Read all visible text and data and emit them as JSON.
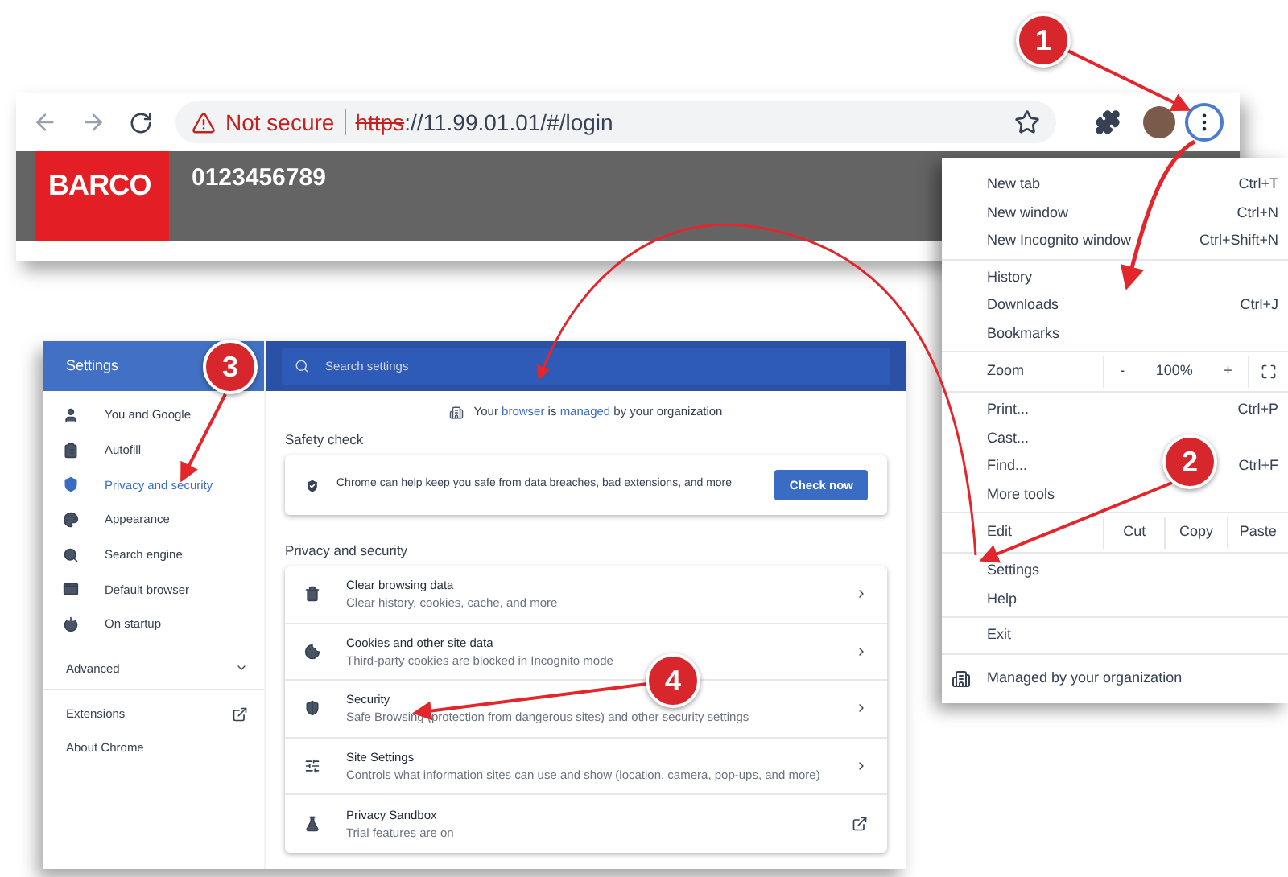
{
  "browser": {
    "warning": "Not secure",
    "url_scheme": "https",
    "url_rest": "://11.99.01.01/#/login",
    "logo": "BARCO",
    "device_id": "0123456789"
  },
  "menu": {
    "groups": [
      [
        {
          "kind": "item",
          "label": "New tab",
          "shortcut": "Ctrl+T"
        },
        {
          "kind": "item",
          "label": "New window",
          "shortcut": "Ctrl+N"
        },
        {
          "kind": "item",
          "label": "New Incognito window",
          "shortcut": "Ctrl+Shift+N"
        }
      ],
      [
        {
          "kind": "item",
          "label": "History"
        },
        {
          "kind": "item",
          "label": "Downloads",
          "shortcut": "Ctrl+J"
        },
        {
          "kind": "item",
          "label": "Bookmarks"
        }
      ],
      [
        {
          "kind": "zoom",
          "label": "Zoom",
          "minus": "-",
          "value": "100%",
          "plus": "+"
        }
      ],
      [
        {
          "kind": "item",
          "label": "Print...",
          "shortcut": "Ctrl+P"
        },
        {
          "kind": "item",
          "label": "Cast..."
        },
        {
          "kind": "item",
          "label": "Find...",
          "shortcut": "Ctrl+F"
        },
        {
          "kind": "item",
          "label": "More tools"
        }
      ],
      [
        {
          "kind": "edit",
          "label": "Edit",
          "actions": [
            "Cut",
            "Copy",
            "Paste"
          ]
        }
      ],
      [
        {
          "kind": "item",
          "label": "Settings"
        },
        {
          "kind": "item",
          "label": "Help"
        }
      ],
      [
        {
          "kind": "item",
          "label": "Exit"
        }
      ]
    ],
    "footer": "Managed by your organization"
  },
  "settings": {
    "title": "Settings",
    "search": {
      "placeholder": "Search settings"
    },
    "sidebar": [
      {
        "label": "You and Google",
        "selected": false
      },
      {
        "label": "Autofill",
        "selected": false
      },
      {
        "label": "Privacy and security",
        "selected": true
      },
      {
        "label": "Appearance",
        "selected": false
      },
      {
        "label": "Search engine",
        "selected": false
      },
      {
        "label": "Default browser",
        "selected": false
      },
      {
        "label": "On startup",
        "selected": false
      }
    ],
    "advanced": "Advanced",
    "extensions": "Extensions",
    "about": "About Chrome",
    "managed_notice": [
      {
        "text": "Your ",
        "link": false
      },
      {
        "text": "browser",
        "link": true
      },
      {
        "text": " is ",
        "link": false
      },
      {
        "text": "managed",
        "link": true
      },
      {
        "text": " by your organization",
        "link": false
      }
    ],
    "safety_heading": "Safety check",
    "safety_text": "Chrome can help keep you safe from data breaches, bad extensions, and more",
    "check_button": "Check now",
    "privacy_heading": "Privacy and security",
    "rows": [
      {
        "title": "Clear browsing data",
        "subtitle": "Clear history, cookies, cache, and more",
        "kind": "arrow"
      },
      {
        "title": "Cookies and other site data",
        "subtitle": "Third-party cookies are blocked in Incognito mode",
        "kind": "arrow"
      },
      {
        "title": "Security",
        "subtitle": "Safe Browsing (protection from dangerous sites) and other security settings",
        "kind": "arrow"
      },
      {
        "title": "Site Settings",
        "subtitle": "Controls what information sites can use and show (location, camera, pop-ups, and more)",
        "kind": "arrow"
      },
      {
        "title": "Privacy Sandbox",
        "subtitle": "Trial features are on",
        "kind": "external"
      }
    ]
  },
  "callouts": [
    {
      "number": "1"
    },
    {
      "number": "2"
    },
    {
      "number": "3"
    },
    {
      "number": "4"
    }
  ]
}
